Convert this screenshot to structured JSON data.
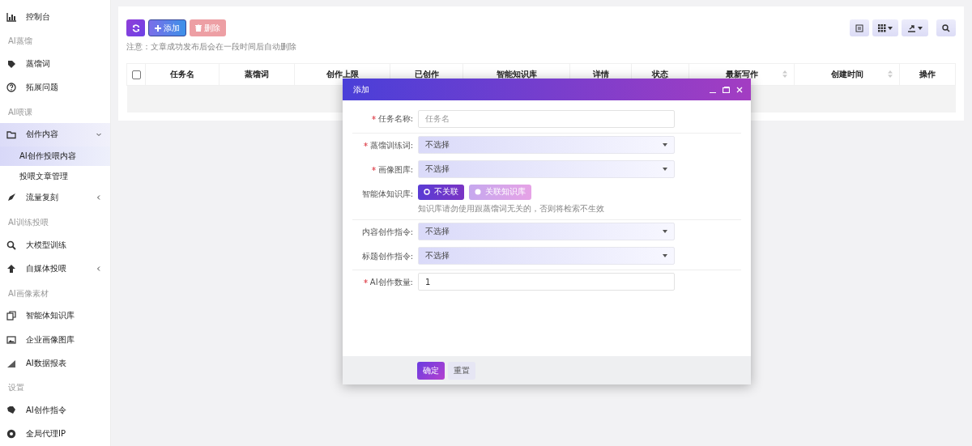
{
  "sidebar": {
    "items": [
      {
        "kind": "item",
        "label": "控制台",
        "selected": false
      },
      {
        "kind": "header",
        "label": "AI蒸馏"
      },
      {
        "kind": "item",
        "label": "蒸馏词",
        "selected": false
      },
      {
        "kind": "item",
        "label": "拓展问题",
        "selected": false
      },
      {
        "kind": "header",
        "label": "AI喂课"
      },
      {
        "kind": "item",
        "label": "创作内容",
        "selected": false,
        "expanded": true,
        "children": [
          {
            "label": "AI创作投喂内容",
            "selected": true
          },
          {
            "label": "投喂文章管理",
            "selected": false
          }
        ]
      },
      {
        "kind": "item",
        "label": "流量复刻",
        "selected": false,
        "expanded": false
      },
      {
        "kind": "header",
        "label": "AI训练投喂"
      },
      {
        "kind": "item",
        "label": "大模型训练",
        "selected": false
      },
      {
        "kind": "item",
        "label": "自媒体投喂",
        "selected": false,
        "expanded": false
      },
      {
        "kind": "header",
        "label": "AI画像素材"
      },
      {
        "kind": "item",
        "label": "智能体知识库",
        "selected": false
      },
      {
        "kind": "item",
        "label": "企业画像图库",
        "selected": false
      },
      {
        "kind": "item",
        "label": "AI数据报表",
        "selected": false
      },
      {
        "kind": "header",
        "label": "设置"
      },
      {
        "kind": "item",
        "label": "AI创作指令",
        "selected": false
      },
      {
        "kind": "item",
        "label": "全局代理IP",
        "selected": false
      }
    ]
  },
  "toolbar": {
    "buttons": [
      {
        "kind": "refresh",
        "disabled": false
      },
      {
        "kind": "add",
        "label": "添加",
        "disabled": false
      },
      {
        "kind": "delete",
        "label": "删除",
        "disabled": true
      }
    ],
    "note": "注意：文章成功发布后会在一段时间后自动删除",
    "tools": [
      {
        "kind": "toggle",
        "dropdown": false
      },
      {
        "kind": "columns",
        "dropdown": true
      },
      {
        "kind": "export",
        "dropdown": true
      },
      {
        "kind": "search",
        "dropdown": false
      }
    ]
  },
  "table": {
    "select_all": {
      "checked": false
    },
    "columns": [
      {
        "label": "任务名",
        "sortable": false
      },
      {
        "label": "蒸馏词",
        "sortable": false
      },
      {
        "label": "创作上限",
        "sortable": false
      },
      {
        "label": "已创作",
        "sortable": false
      },
      {
        "label": "智能知识库",
        "sortable": false
      },
      {
        "label": "详情",
        "sortable": false
      },
      {
        "label": "状态",
        "sortable": false
      },
      {
        "label": "最新写作",
        "sortable": true
      },
      {
        "label": "创建时间",
        "sortable": true
      },
      {
        "label": "操作",
        "sortable": false
      }
    ]
  },
  "dialog": {
    "title": "添加",
    "sections": [
      {
        "fields": [
          {
            "kind": "text",
            "label": "任务名称:",
            "required": true,
            "placeholder": "任务名"
          }
        ]
      },
      {
        "fields": [
          {
            "kind": "select",
            "label": "蒸馏训练词:",
            "required": true,
            "value": "不选择"
          },
          {
            "kind": "select",
            "label": "画像图库:",
            "required": true,
            "value": "不选择"
          },
          {
            "kind": "radio",
            "label": "智能体知识库:",
            "required": false,
            "options": [
              {
                "label": "不关联",
                "selected": true
              },
              {
                "label": "关联知识库",
                "selected": false
              }
            ],
            "hint": "知识库请勿使用跟蒸馏词无关的，否则将检索不生效"
          }
        ]
      },
      {
        "fields": [
          {
            "kind": "select",
            "label": "内容创作指令:",
            "required": false,
            "value": "不选择"
          },
          {
            "kind": "select",
            "label": "标题创作指令:",
            "required": false,
            "value": "不选择"
          }
        ]
      },
      {
        "fields": [
          {
            "kind": "text",
            "label": "AI创作数量:",
            "required": true,
            "value": "1"
          }
        ]
      }
    ],
    "buttons": [
      {
        "kind": "primary",
        "label": "确定"
      },
      {
        "kind": "default",
        "label": "重置"
      }
    ]
  }
}
